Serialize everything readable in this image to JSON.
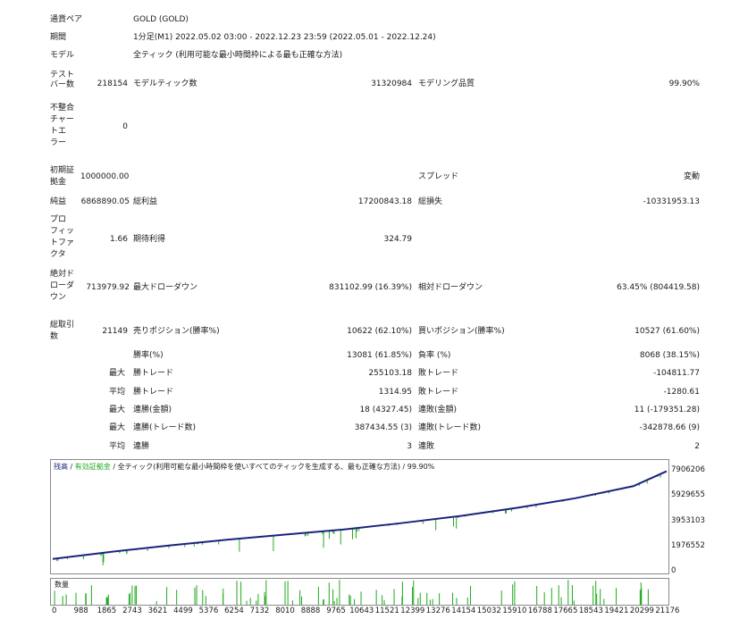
{
  "report": {
    "symbol_label": "通貨ペア",
    "symbol": "GOLD (GOLD)",
    "period_label": "期間",
    "period": "1分足(M1) 2022.05.02 03:00 - 2022.12.23 23:59 (2022.05.01 - 2022.12.24)",
    "model_label": "モデル",
    "model": "全ティック (利用可能な最小時間枠による最も正確な方法)",
    "bars_label": "テスト\nバー数",
    "bars": "218154",
    "ticks_label": "モデルティック数",
    "ticks": "31320984",
    "quality_label": "モデリング品質",
    "quality": "99.90%",
    "mismatch_label": "不整合\nチャー\nトエ\nラー",
    "mismatch": "0",
    "deposit_label": "初期証\n拠金",
    "deposit": "1000000.00",
    "spread_label": "スプレッド",
    "spread": "変動",
    "net_label": "純益",
    "net": "6868890.05",
    "gross_profit_label": "総利益",
    "gross_profit": "17200843.18",
    "gross_loss_label": "総損失",
    "gross_loss": "-10331953.13",
    "pf_label": "プロ\nフィッ\nトファ\nクタ",
    "pf": "1.66",
    "expected_label": "期待利得",
    "expected": "324.79",
    "abs_dd_label": "絶対ド\nローダ\nウン",
    "abs_dd": "713979.92",
    "max_dd_label": "最大ドローダウン",
    "max_dd": "831102.99 (16.39%)",
    "rel_dd_label": "相対ドローダウン",
    "rel_dd": "63.45% (804419.58)",
    "trades_label": "総取引\n数",
    "trades": "21149",
    "short_label": "売りポジション(勝率%)",
    "short": "10622 (62.10%)",
    "long_label": "買いポジション(勝率%)",
    "long": "10527 (61.60%)",
    "win_pct_label": "勝率(%)",
    "win_pct": "13081 (61.85%)",
    "loss_pct_label": "負率 (%)",
    "loss_pct": "8068 (38.15%)",
    "max_label": "最大",
    "avg_label": "平均",
    "largest_win_label": "勝トレード",
    "largest_win": "255103.18",
    "largest_loss_label": "敗トレード",
    "largest_loss": "-104811.77",
    "avg_win_label": "勝トレード",
    "avg_win": "1314.95",
    "avg_loss_label": "敗トレード",
    "avg_loss": "-1280.61",
    "cons_wins_amt_label": "連勝(金額)",
    "cons_wins_amt": "18 (4327.45)",
    "cons_losses_amt_label": "連敗(金額)",
    "cons_losses_amt": "11 (-179351.28)",
    "cons_profit_label": "連勝(トレード数)",
    "cons_profit": "387434.55 (3)",
    "cons_loss_label": "連敗(トレード数)",
    "cons_loss": "-342878.66 (9)",
    "avg_cons_wins_label": "連勝",
    "avg_cons_wins": "3",
    "avg_cons_losses_label": "連敗",
    "avg_cons_losses": "2"
  },
  "chart_data": {
    "type": "line",
    "legend": "残高 / 有効証拠金 / 全ティック(利用可能な最小時間枠を使いすべてのティックを生成する、最も正確な方法) / 99.90%",
    "legend_parts": {
      "balance": "残高",
      "equity": "有効証拠金",
      "rest": "全ティック(利用可能な最小時間枠を使いすべてのティックを生成する、最も正確な方法) / 99.90%"
    },
    "yticks": [
      "7906206",
      "5929655",
      "3953103",
      "1976552",
      "0"
    ],
    "ylim": [
      0,
      7906206
    ],
    "xticks": [
      "0",
      "988",
      "1865",
      "2743",
      "3621",
      "4499",
      "5376",
      "6254",
      "7132",
      "8010",
      "8888",
      "9765",
      "10643",
      "11521",
      "12399",
      "13276",
      "14154",
      "15032",
      "15910",
      "16788",
      "17665",
      "18543",
      "19421",
      "20299",
      "21176"
    ],
    "x": [
      0,
      2000,
      4000,
      6000,
      8000,
      10000,
      12000,
      14000,
      16000,
      18000,
      20000,
      21149
    ],
    "balance": [
      1000000,
      1550000,
      2050000,
      2500000,
      2900000,
      3300000,
      3800000,
      4350000,
      5000000,
      5750000,
      6700000,
      7868890
    ],
    "colors": {
      "balance": "#1a237e",
      "equity": "#1faa1f",
      "volume": "#1faa1f"
    },
    "volume_label": "数量"
  }
}
